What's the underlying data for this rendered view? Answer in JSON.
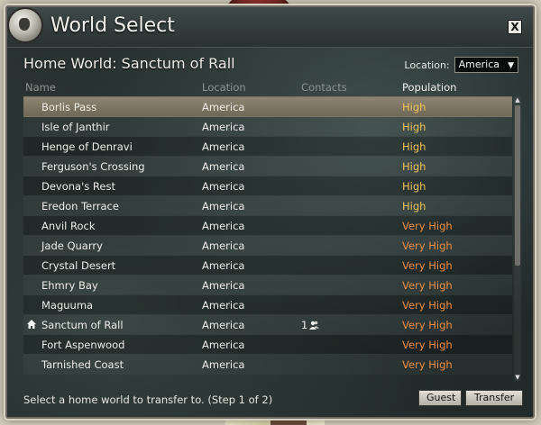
{
  "window": {
    "title": "World Select",
    "close_glyph": "X"
  },
  "home_world_title": "Home World: Sanctum of Rall",
  "location_filter": {
    "label": "Location:",
    "selected": "America"
  },
  "columns": {
    "name": "Name",
    "location": "Location",
    "contacts": "Contacts",
    "population": "Population"
  },
  "worlds": [
    {
      "name": "Borlis Pass",
      "location": "America",
      "contacts": "",
      "population": "High",
      "selected": true
    },
    {
      "name": "Isle of Janthir",
      "location": "America",
      "contacts": "",
      "population": "High"
    },
    {
      "name": "Henge of Denravi",
      "location": "America",
      "contacts": "",
      "population": "High"
    },
    {
      "name": "Ferguson's Crossing",
      "location": "America",
      "contacts": "",
      "population": "High"
    },
    {
      "name": "Devona's Rest",
      "location": "America",
      "contacts": "",
      "population": "High"
    },
    {
      "name": "Eredon Terrace",
      "location": "America",
      "contacts": "",
      "population": "High"
    },
    {
      "name": "Anvil Rock",
      "location": "America",
      "contacts": "",
      "population": "Very High"
    },
    {
      "name": "Jade Quarry",
      "location": "America",
      "contacts": "",
      "population": "Very High"
    },
    {
      "name": "Crystal Desert",
      "location": "America",
      "contacts": "",
      "population": "Very High"
    },
    {
      "name": "Ehmry Bay",
      "location": "America",
      "contacts": "",
      "population": "Very High"
    },
    {
      "name": "Maguuma",
      "location": "America",
      "contacts": "",
      "population": "Very High"
    },
    {
      "name": "Sanctum of Rall",
      "location": "America",
      "contacts": "1",
      "population": "Very High",
      "home": true
    },
    {
      "name": "Fort Aspenwood",
      "location": "America",
      "contacts": "",
      "population": "Very High"
    },
    {
      "name": "Tarnished Coast",
      "location": "America",
      "contacts": "",
      "population": "Very High"
    }
  ],
  "status_text": "Select a home world to transfer to. (Step 1 of 2)",
  "buttons": {
    "guest": "Guest",
    "transfer": "Transfer"
  },
  "colors": {
    "high": "#f0c25a",
    "very_high": "#f08e44"
  },
  "icons": {
    "home": "home-icon",
    "contacts": "contacts-icon",
    "dropdown": "chevron-down-icon"
  }
}
